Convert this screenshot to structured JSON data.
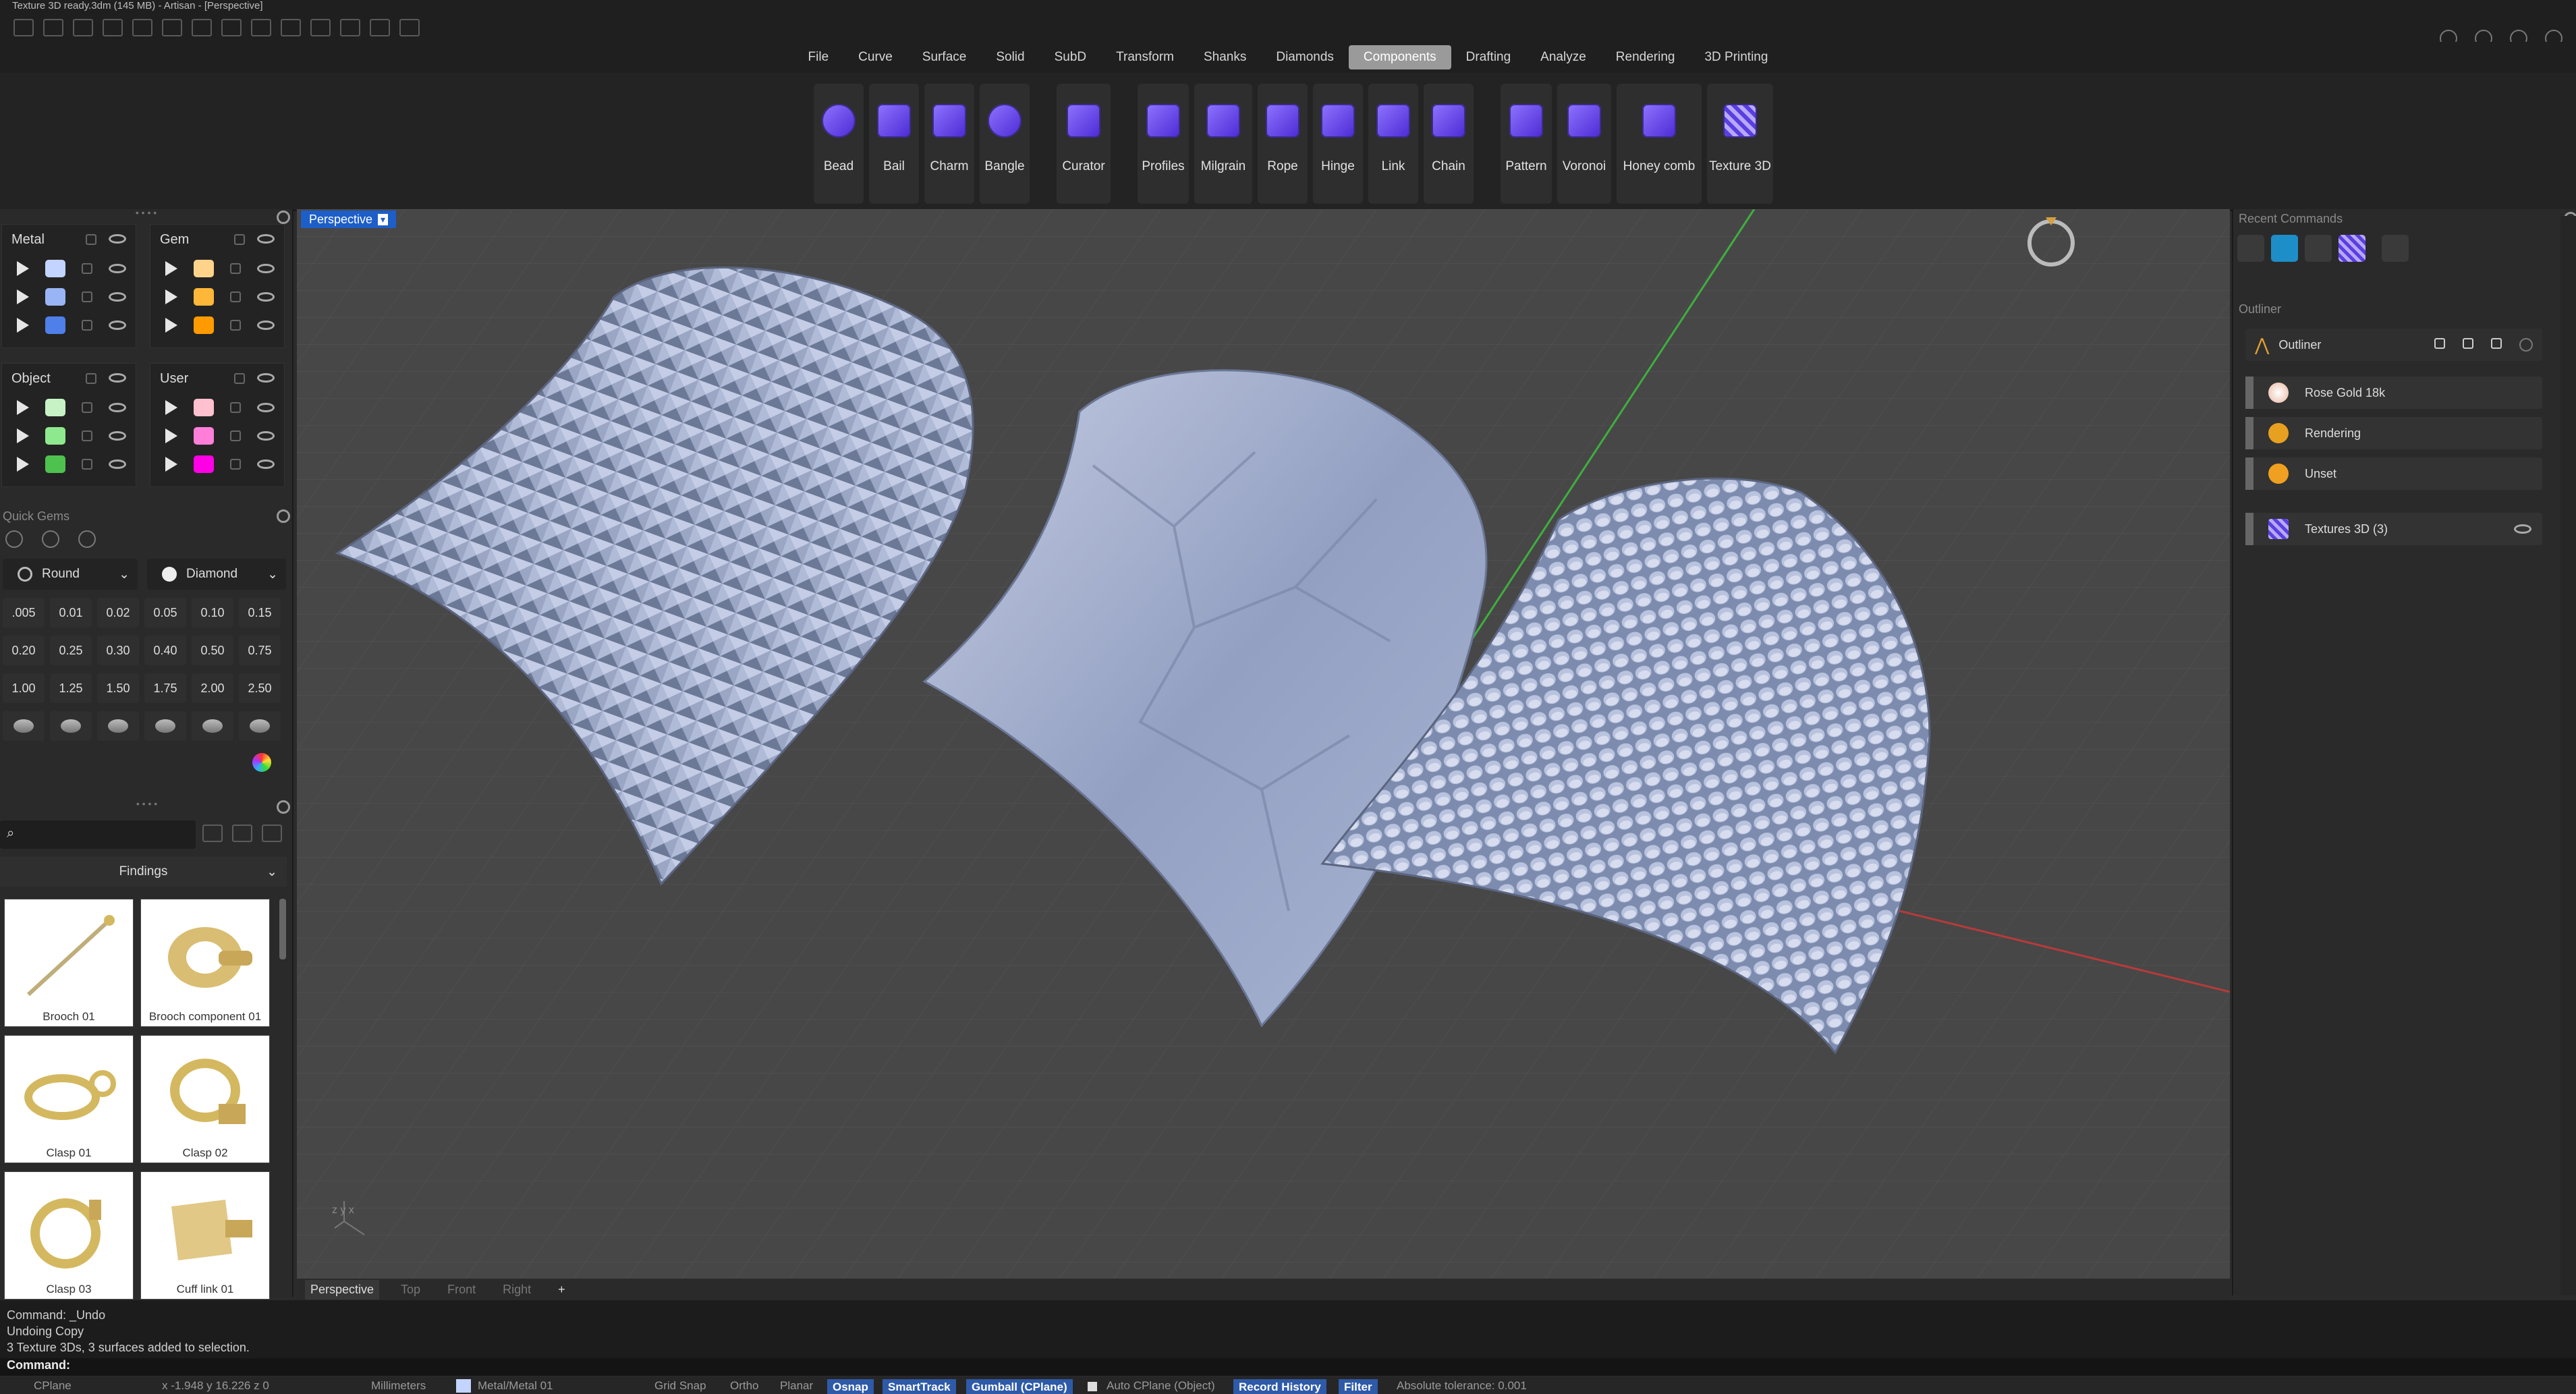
{
  "window": {
    "title": "Texture 3D ready.3dm (145 MB) - Artisan - [Perspective]"
  },
  "menu": [
    "File",
    "Curve",
    "Surface",
    "Solid",
    "SubD",
    "Transform",
    "Shanks",
    "Diamonds",
    "Components",
    "Drafting",
    "Analyze",
    "Rendering",
    "3D Printing"
  ],
  "menu_active": "Components",
  "ribbon": [
    "Bead",
    "Bail",
    "Charm",
    "Bangle",
    "Curator",
    "Profiles",
    "Milgrain",
    "Rope",
    "Hinge",
    "Link",
    "Chain",
    "Pattern",
    "Voronoi",
    "Honey comb",
    "Texture 3D"
  ],
  "layers": {
    "metal": {
      "label": "Metal",
      "colors": [
        "#c2d4ff",
        "#9ab5f5",
        "#4f7fe8"
      ]
    },
    "gem": {
      "label": "Gem",
      "colors": [
        "#ffd48a",
        "#ffb73a",
        "#ff9a00"
      ]
    },
    "object": {
      "label": "Object",
      "colors": [
        "#c6f2c6",
        "#8ee88e",
        "#4ec24e"
      ]
    },
    "user": {
      "label": "User",
      "colors": [
        "#ffc0d0",
        "#ff7fd8",
        "#ff00e6"
      ]
    }
  },
  "quick_gems": {
    "title": "Quick Gems",
    "shape": "Round",
    "material": "Diamond",
    "sizes": [
      ".005",
      "0.01",
      "0.02",
      "0.05",
      "0.10",
      "0.15",
      "0.20",
      "0.25",
      "0.30",
      "0.40",
      "0.50",
      "0.75",
      "1.00",
      "1.25",
      "1.50",
      "1.75",
      "2.00",
      "2.50"
    ]
  },
  "findings": {
    "category": "Findings",
    "items": [
      "Brooch 01",
      "Brooch component 01",
      "Clasp 01",
      "Clasp 02",
      "Clasp 03",
      "Cuff link 01"
    ]
  },
  "viewport": {
    "label": "Perspective",
    "tabs": [
      "Perspective",
      "Top",
      "Front",
      "Right"
    ],
    "axis_label": "z y x"
  },
  "right_panel": {
    "recent_title": "Recent Commands",
    "outliner_title": "Outliner",
    "outliner_header": "Outliner",
    "items": [
      "Rose Gold 18k",
      "Rendering",
      "Unset",
      "Textures 3D (3)"
    ]
  },
  "history": [
    "Command: _Undo",
    "Undoing Copy",
    "3 Texture 3Ds, 3 surfaces added to selection."
  ],
  "command_label": "Command:",
  "status": {
    "cplane": "CPlane",
    "coords": "x -1.948 y 16.226 z 0",
    "units": "Millimeters",
    "layer": "Metal/Metal 01",
    "grid_snap": "Grid Snap",
    "ortho": "Ortho",
    "planar": "Planar",
    "osnap": "Osnap",
    "smarttrack": "SmartTrack",
    "gumball": "Gumball (CPlane)",
    "auto_cplane": "Auto CPlane (Object)",
    "record_history": "Record History",
    "filter": "Filter",
    "tolerance": "Absolute tolerance: 0.001"
  }
}
